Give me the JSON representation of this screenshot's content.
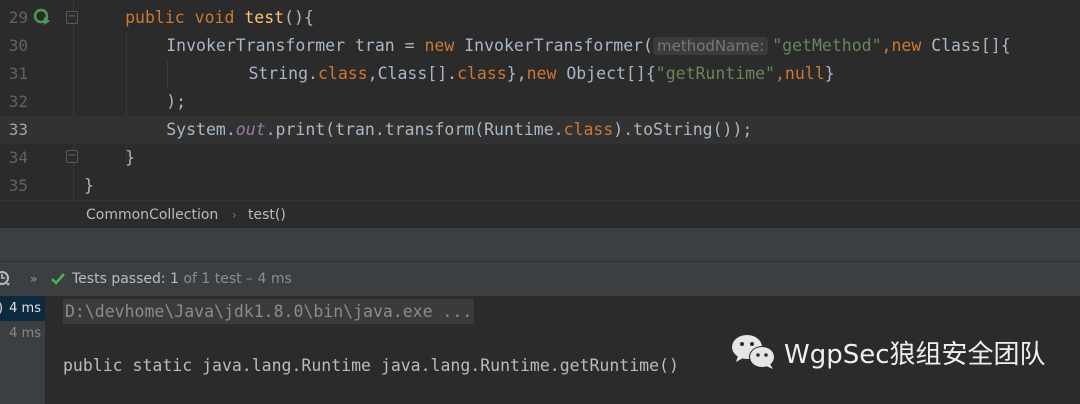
{
  "editor": {
    "lines": [
      {
        "num": "29",
        "parts": [
          [
            "kw",
            "public void "
          ],
          [
            "fn",
            "test"
          ],
          [
            "",
            "(){"
          ]
        ],
        "indent": 4
      },
      {
        "num": "30",
        "indent": 8
      },
      {
        "num": "31",
        "indent": 16
      },
      {
        "num": "32",
        "parts": [
          [
            "",
            ");"
          ]
        ],
        "indent": 8
      },
      {
        "num": "33",
        "indent": 8
      },
      {
        "num": "34",
        "parts": [
          [
            "",
            "}"
          ]
        ],
        "indent": 4
      },
      {
        "num": "35",
        "parts": [
          [
            "",
            "}"
          ]
        ],
        "indent": 0
      }
    ],
    "line30": {
      "a": "InvokerTransformer tran = ",
      "b": "new ",
      "c": "InvokerTransformer(",
      "hint": "methodName:",
      "d": "\"getMethod\"",
      "e": ",new ",
      "f": "Class[]{"
    },
    "line31": {
      "a": "String.",
      "b": "class",
      "c": ",Class[].",
      "d": "class",
      "e": "},",
      "f": "new ",
      "g": "Object[]{",
      "h": "\"getRuntime\"",
      "i": ",null",
      "j": "}"
    },
    "line33": {
      "a": "System.",
      "b": "out",
      "c": ".print(tran.transform(Runtime.",
      "d": "class",
      "e": ").toString());"
    }
  },
  "breadcrumb": {
    "class": "CommonCollection",
    "sep": "›",
    "method": "test()"
  },
  "test_toolbar": {
    "expand": "»",
    "status": "Tests passed:",
    "count": "1",
    "detail": "of 1 test – 4 ms"
  },
  "test_tree": {
    "selected_time": "4 ms",
    "child_time": "4 ms",
    "selected_prefix": ")"
  },
  "console": {
    "command": "D:\\devhome\\Java\\jdk1.8.0\\bin\\java.exe ...",
    "output": "public static java.lang.Runtime java.lang.Runtime.getRuntime()"
  },
  "watermark": {
    "text": "WgpSec狼组安全团队"
  },
  "colors": {
    "background": "#2b2b2b",
    "keyword": "#cc7832",
    "string": "#6a8759",
    "method": "#ffc66d",
    "field": "#9876aa",
    "pass": "#4caf50"
  }
}
